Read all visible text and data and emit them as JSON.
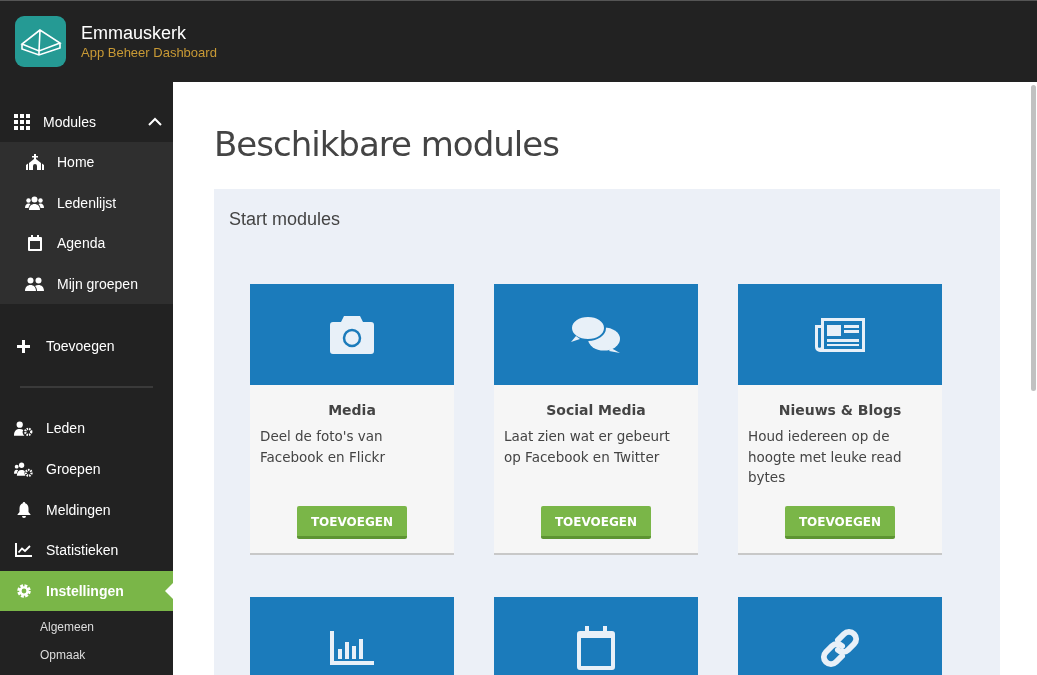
{
  "header": {
    "app_name": "Emmauskerk",
    "subtitle": "App Beheer Dashboard"
  },
  "sidebar": {
    "modules": {
      "label": "Modules",
      "expanded": true,
      "items": [
        {
          "label": "Home",
          "selected": false
        },
        {
          "label": "Ledenlijst",
          "selected": false
        },
        {
          "label": "Agenda",
          "selected": false
        },
        {
          "label": "Mijn groepen",
          "selected": false
        }
      ]
    },
    "add_item": {
      "label": "Toevoegen"
    },
    "items": [
      {
        "label": "Leden",
        "selected": false
      },
      {
        "label": "Groepen",
        "selected": false
      },
      {
        "label": "Meldingen",
        "selected": false
      },
      {
        "label": "Statistieken",
        "selected": false
      },
      {
        "label": "Instellingen",
        "selected": true,
        "children": [
          {
            "label": "Algemeen"
          },
          {
            "label": "Opmaak"
          }
        ]
      }
    ]
  },
  "main": {
    "title": "Beschikbare modules",
    "section": {
      "title": "Start modules",
      "cards": [
        {
          "kind": "full",
          "title": "Media",
          "description": "Deel de foto's van Facebook en Flickr",
          "button": "TOEVOEGEN"
        },
        {
          "kind": "full",
          "title": "Social Media",
          "description": "Laat zien wat er gebeurt op Facebook en Twitter",
          "button": "TOEVOEGEN"
        },
        {
          "kind": "full",
          "title": "Nieuws & Blogs",
          "description": "Houd iedereen op de hoogte met leuke read bytes",
          "button": "TOEVOEGEN"
        },
        {
          "kind": "cut"
        },
        {
          "kind": "cut"
        },
        {
          "kind": "cut"
        }
      ]
    }
  }
}
